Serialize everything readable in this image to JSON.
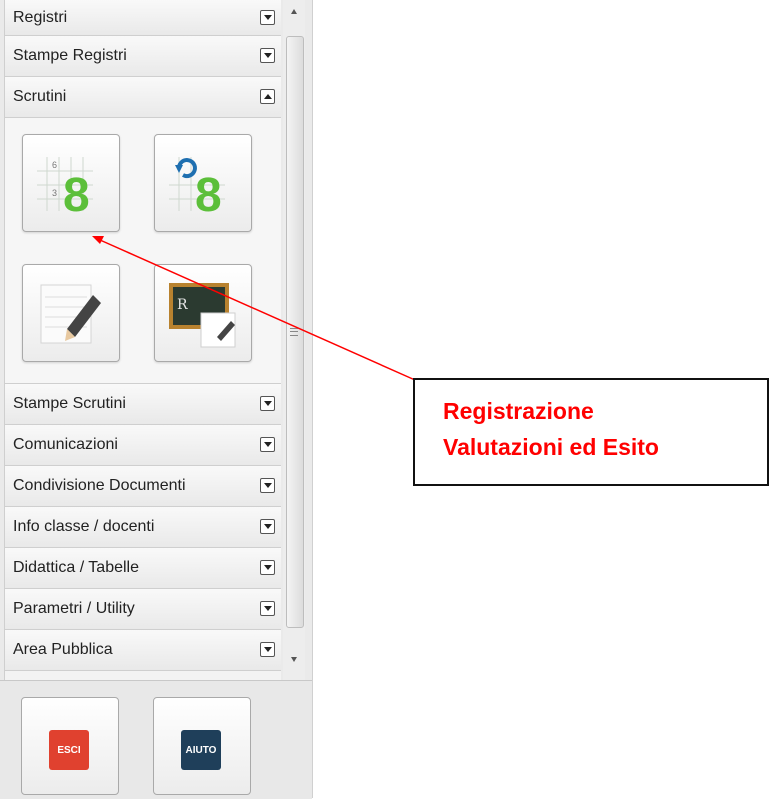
{
  "menu": {
    "sections": [
      {
        "label": "Registri",
        "state": "collapsed"
      },
      {
        "label": "Stampe Registri",
        "state": "collapsed"
      },
      {
        "label": "Scrutini",
        "state": "expanded"
      },
      {
        "label": "Stampe Scrutini",
        "state": "collapsed"
      },
      {
        "label": "Comunicazioni",
        "state": "collapsed"
      },
      {
        "label": "Condivisione Documenti",
        "state": "collapsed"
      },
      {
        "label": "Info classe / docenti",
        "state": "collapsed"
      },
      {
        "label": "Didattica / Tabelle",
        "state": "collapsed"
      },
      {
        "label": "Parametri / Utility",
        "state": "collapsed"
      },
      {
        "label": "Area Pubblica",
        "state": "collapsed"
      }
    ],
    "scrutini_tiles": [
      {
        "icon": "grade-grid-icon",
        "digit": "8",
        "small_digits": [
          "6",
          "3"
        ]
      },
      {
        "icon": "grade-refresh-icon",
        "digit": "8"
      },
      {
        "icon": "notepad-pencil-icon"
      },
      {
        "icon": "blackboard-icon",
        "text": "R"
      }
    ]
  },
  "bottom": {
    "esci_label": "ESCI",
    "aiuto_label": "AIUTO",
    "esci_color": "#e0412f",
    "aiuto_color": "#1f3f5a"
  },
  "callout": {
    "line1": "Registrazione",
    "line2": "Valutazioni ed Esito",
    "color": "#ff0000"
  }
}
